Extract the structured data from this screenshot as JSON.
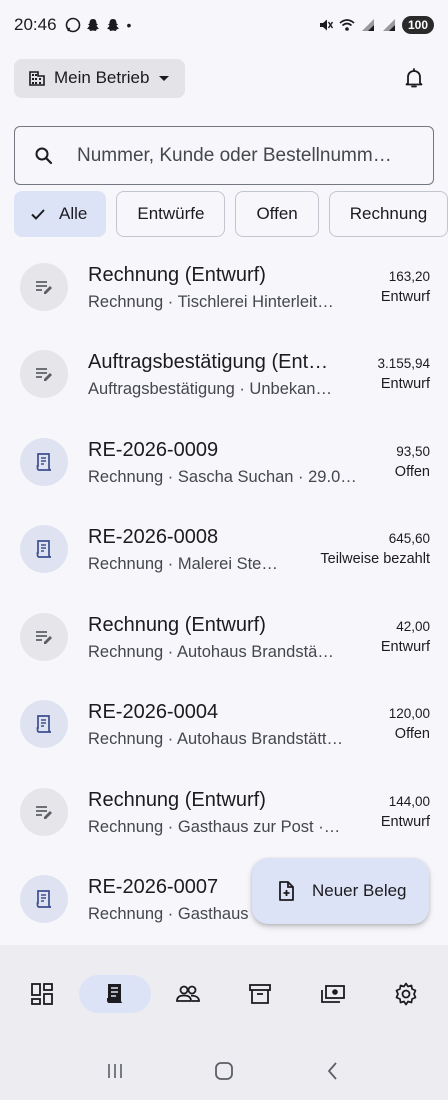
{
  "status_bar": {
    "time": "20:46",
    "dot": "•",
    "battery": "100",
    "left_icons": [
      "whatsapp-icon",
      "snapchat-icon",
      "snapchat-icon"
    ],
    "right_icons": [
      "mute-icon",
      "wifi-icon",
      "signal-icon",
      "signal-icon"
    ]
  },
  "header": {
    "business_label": "Mein Betrieb",
    "business_icon": "building-icon",
    "notification_icon": "bell-icon"
  },
  "search": {
    "placeholder": "Nummer, Kunde oder Bestellnumm…",
    "icon": "search-icon"
  },
  "filters": [
    {
      "label": "Alle",
      "selected": true
    },
    {
      "label": "Entwürfe",
      "selected": false
    },
    {
      "label": "Offen",
      "selected": false
    },
    {
      "label": "Rechnung",
      "selected": false
    }
  ],
  "documents": [
    {
      "title": "Rechnung (Entwurf)",
      "subtitle": "Rechnung · Tischlerei Hinterleit…",
      "amount": "163,20",
      "status": "Entwurf",
      "kind": "draft"
    },
    {
      "title": "Auftragsbestätigung (Ent…",
      "subtitle": "Auftragsbestätigung · Unbekan…",
      "amount": "3.155,94",
      "status": "Entwurf",
      "kind": "draft"
    },
    {
      "title": "RE-2026-0009",
      "subtitle": "Rechnung · Sascha Suchan · 29.0…",
      "amount": "93,50",
      "status": "Offen",
      "kind": "invoice"
    },
    {
      "title": "RE-2026-0008",
      "subtitle": "Rechnung · Malerei Ste…",
      "amount": "645,60",
      "status": "Teilweise bezahlt",
      "kind": "invoice"
    },
    {
      "title": "Rechnung (Entwurf)",
      "subtitle": "Rechnung · Autohaus Brandstä…",
      "amount": "42,00",
      "status": "Entwurf",
      "kind": "draft"
    },
    {
      "title": "RE-2026-0004",
      "subtitle": "Rechnung · Autohaus Brandstätt…",
      "amount": "120,00",
      "status": "Offen",
      "kind": "invoice"
    },
    {
      "title": "Rechnung (Entwurf)",
      "subtitle": "Rechnung · Gasthaus zur Post ·…",
      "amount": "144,00",
      "status": "Entwurf",
      "kind": "draft"
    },
    {
      "title": "RE-2026-0007",
      "subtitle": "Rechnung · Gasthaus",
      "amount": "",
      "status": "",
      "kind": "invoice"
    }
  ],
  "fab": {
    "label": "Neuer Beleg",
    "icon": "add-document-icon"
  },
  "bottom_nav": [
    {
      "name": "dashboard-icon",
      "active": false
    },
    {
      "name": "receipt-icon",
      "active": true
    },
    {
      "name": "customers-icon",
      "active": false
    },
    {
      "name": "archive-icon",
      "active": false
    },
    {
      "name": "payments-icon",
      "active": false
    },
    {
      "name": "settings-icon",
      "active": false
    }
  ],
  "colors": {
    "background": "#f7f6fb",
    "accent_container": "#dde3f7",
    "nav_background": "#ececf1",
    "text_primary": "#1c1b1f",
    "text_secondary": "#44474e"
  }
}
